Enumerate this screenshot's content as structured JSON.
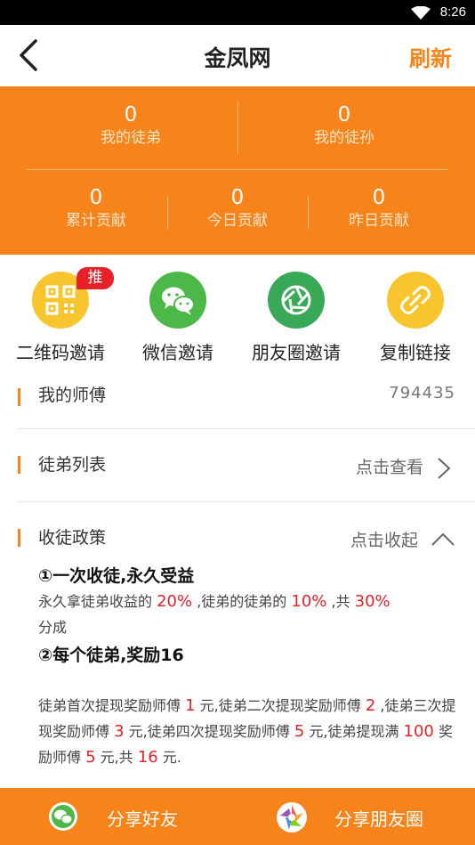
{
  "status_bar": {
    "time": "8:26"
  },
  "nav": {
    "title": "金凤网",
    "refresh_label": "刷新"
  },
  "stats": {
    "top": [
      {
        "value": "0",
        "label": "我的徒弟"
      },
      {
        "value": "0",
        "label": "我的徒孙"
      }
    ],
    "bottom": [
      {
        "value": "0",
        "label": "累计贡献"
      },
      {
        "value": "0",
        "label": "今日贡献"
      },
      {
        "value": "0",
        "label": "昨日贡献"
      }
    ]
  },
  "invites": [
    {
      "label": "二维码邀请",
      "badge": "推荐",
      "icon": "qrcode-icon",
      "color": "#f8c52f"
    },
    {
      "label": "微信邀请",
      "icon": "wechat-icon",
      "color": "#4cb847"
    },
    {
      "label": "朋友圈邀请",
      "icon": "moments-icon",
      "color": "#38a957"
    },
    {
      "label": "复制链接",
      "icon": "link-icon",
      "color": "#f8c52f"
    }
  ],
  "master": {
    "title": "我的师傅",
    "value": "794435"
  },
  "apprentice_list": {
    "title": "徒弟列表",
    "link": "点击查看"
  },
  "policy": {
    "title": "收徒政策",
    "link": "点击收起",
    "rule1_heading": "①一次收徒,永久受益",
    "rule1": {
      "t1": "永久拿徒弟收益的 ",
      "p1": "20%",
      "t2": " ,徒弟的徒弟的 ",
      "p2": "10%",
      "t3": " ,共 ",
      "p3": "30%",
      "t4": "分成"
    },
    "rule2_heading": "②每个徒弟,奖励16",
    "rule2": {
      "t1": "徒弟首次提现奖励师傅 ",
      "n1": "1",
      "t2": " 元,徒弟二次提现奖励师傅 ",
      "n2": "2",
      "t3": " ,徒弟三次提现奖励师傅 ",
      "n3": "3",
      "t4": " 元,徒弟四次提现奖励师傅 ",
      "n4": "5",
      "t5": " 元,徒弟提现满 ",
      "n5": "100",
      "t6": " 奖励师傅 ",
      "n6": "5",
      "t7": " 元,共 ",
      "n7": "16",
      "t8": " 元."
    }
  },
  "bottom_bar": {
    "share_friends": "分享好友",
    "share_moments": "分享朋友圈"
  },
  "colors": {
    "accent": "#f6841b",
    "highlight": "#e62129"
  }
}
